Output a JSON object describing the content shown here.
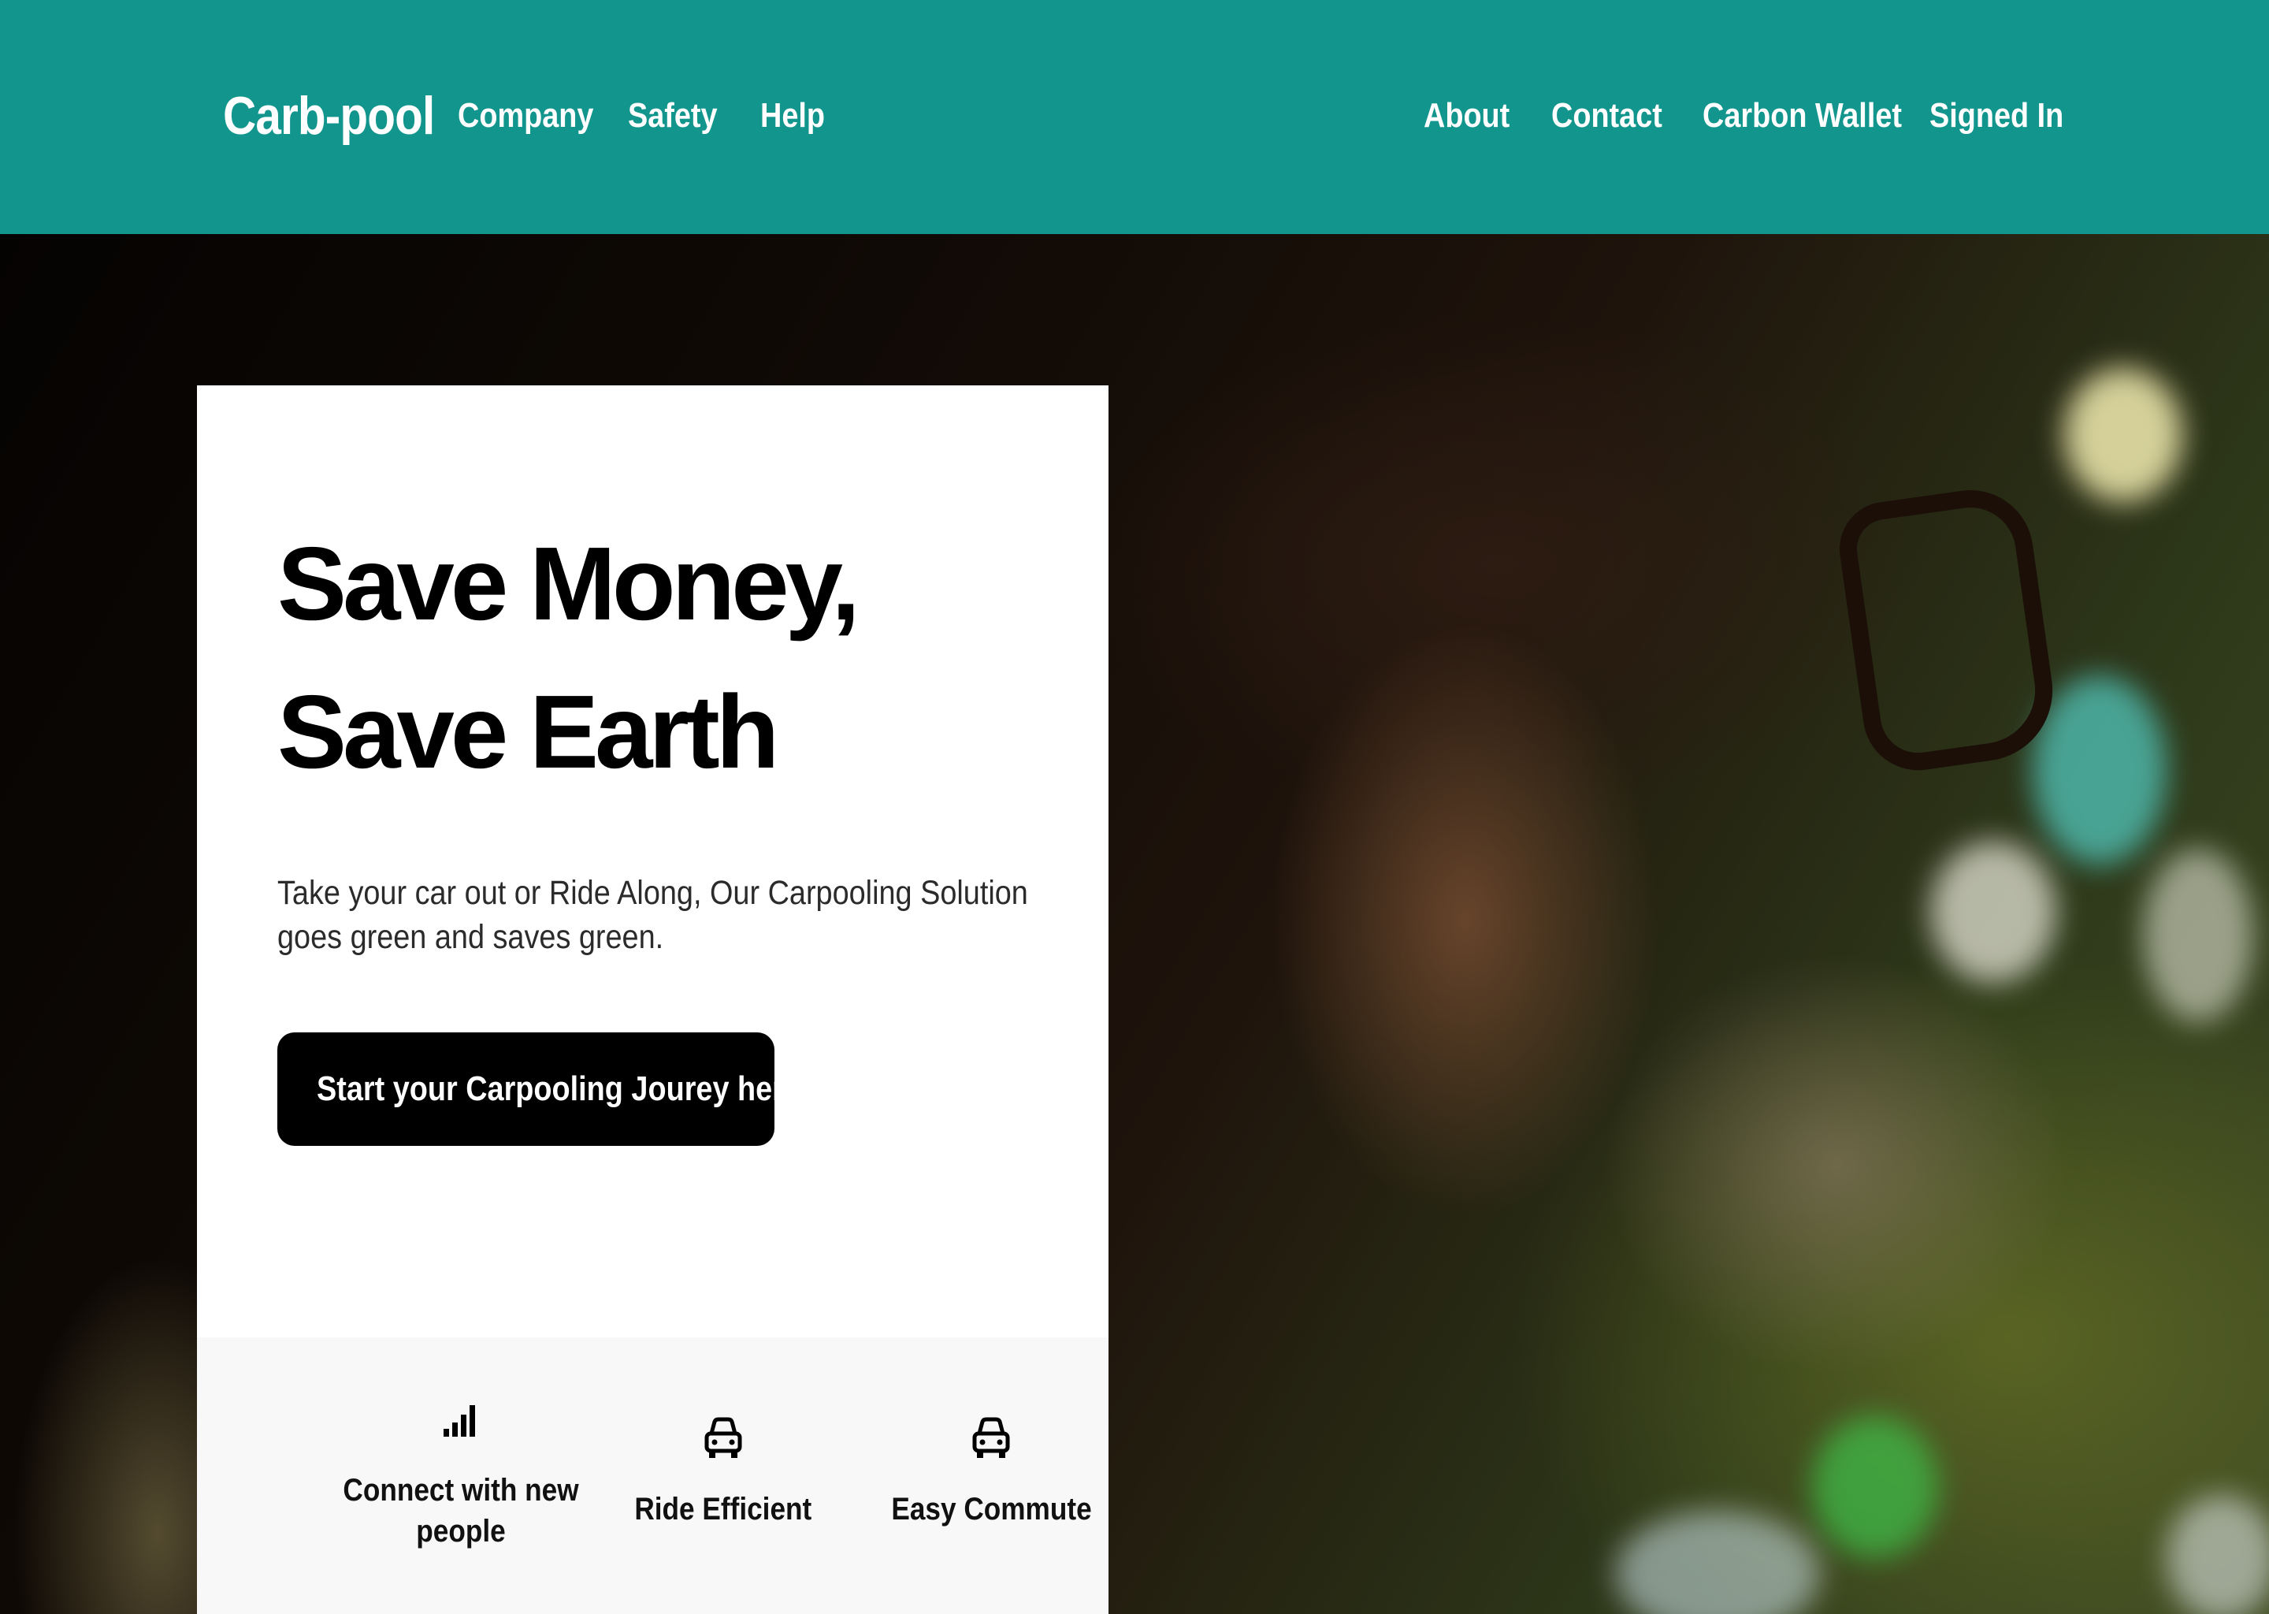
{
  "navbar": {
    "logo": "Carb-pool",
    "left_links": [
      "Company",
      "Safety",
      "Help"
    ],
    "right_links": [
      "About",
      "Contact",
      "Carbon Wallet",
      "Signed In"
    ],
    "background_color": "#12958d"
  },
  "hero": {
    "headline": "Save Money, Save Earth",
    "subtext": "Take your car out or Ride Along, Our Carpooling Solution goes green and saves green.",
    "cta_label": "Start your Carpooling Jourey here"
  },
  "features": [
    {
      "icon": "signal-bars-icon",
      "label": "Connect with new people"
    },
    {
      "icon": "car-front-icon",
      "label": "Ride Efficient"
    },
    {
      "icon": "car-front-icon",
      "label": "Easy Commute"
    }
  ]
}
